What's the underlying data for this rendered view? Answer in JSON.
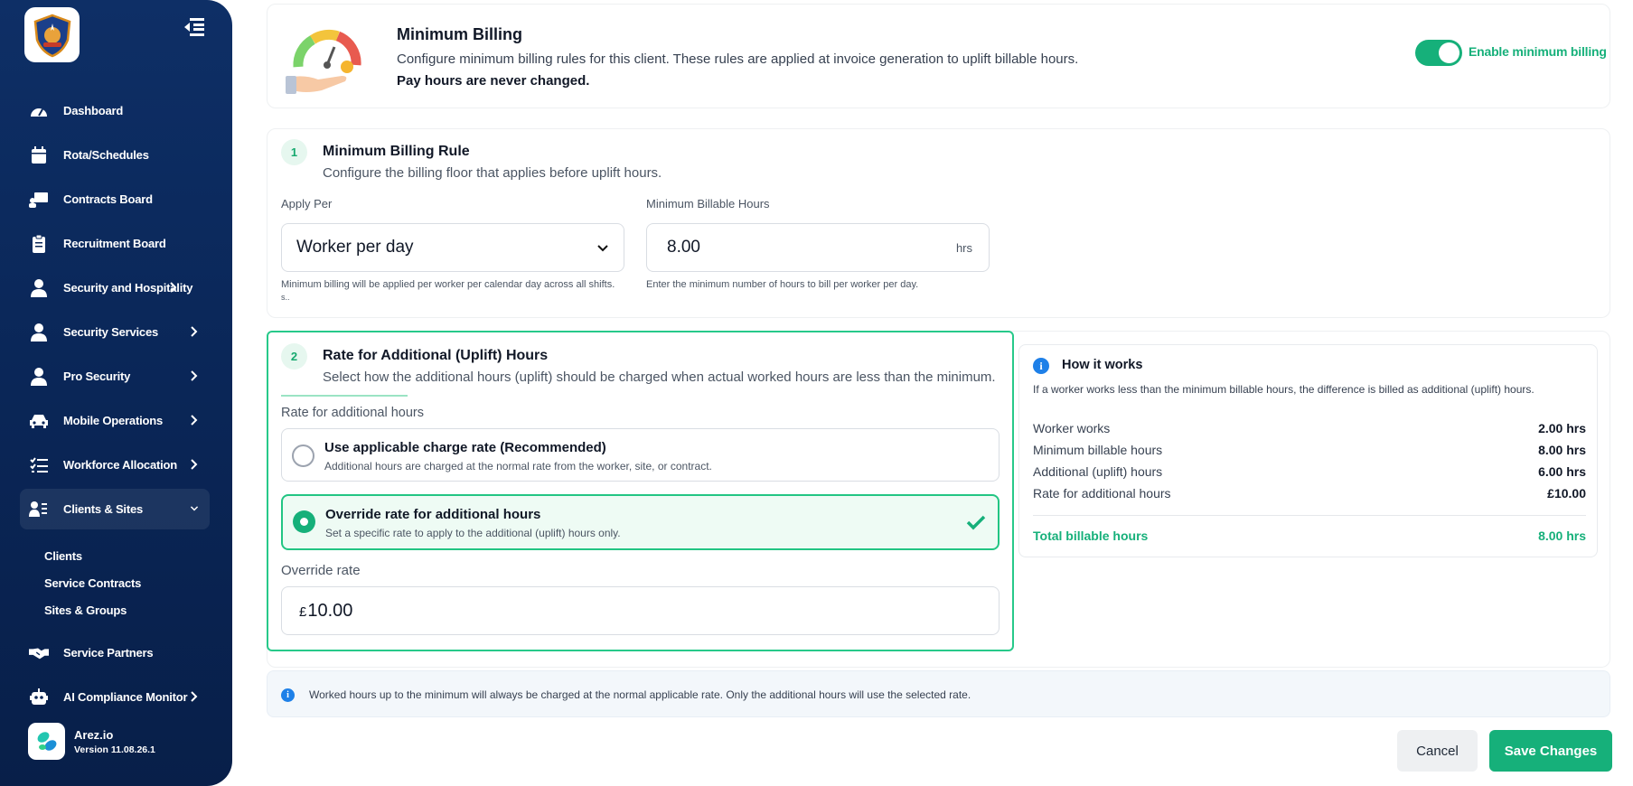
{
  "sidebar": {
    "items": [
      {
        "label": "Dashboard",
        "icon": "dashboard-gauge-icon"
      },
      {
        "label": "Rota/Schedules",
        "icon": "calendar-icon"
      },
      {
        "label": "Contracts Board",
        "icon": "presentation-board-icon"
      },
      {
        "label": "Recruitment Board",
        "icon": "clipboard-icon"
      },
      {
        "label": "Security and Hospitality",
        "icon": "user-icon"
      },
      {
        "label": "Security Services",
        "icon": "user-icon"
      },
      {
        "label": "Pro Security",
        "icon": "user-icon"
      },
      {
        "label": "Mobile Operations",
        "icon": "car-icon"
      },
      {
        "label": "Workforce Allocation",
        "icon": "list-check-icon"
      },
      {
        "label": "Clients & Sites",
        "icon": "clients-icon"
      }
    ],
    "subitems": [
      "Clients",
      "Service Contracts",
      "Sites & Groups"
    ],
    "bottom_items": [
      {
        "label": "Service Partners",
        "icon": "handshake-icon"
      },
      {
        "label": "AI Compliance Monitor",
        "icon": "robot-icon"
      }
    ],
    "brand_name": "Arez.io",
    "version": "Version 11.08.26.1"
  },
  "header": {
    "title": "Minimum Billing",
    "description": "Configure minimum billing rules for this client. These rules are applied at invoice generation to uplift billable hours.",
    "note_bold": "Pay hours are never changed.",
    "toggle_label": "Enable minimum billing",
    "toggle_on": true
  },
  "section1": {
    "step": "1",
    "title": "Minimum Billing Rule",
    "subtitle": "Configure the billing floor that applies before uplift hours.",
    "apply_per_label": "Apply Per",
    "apply_per_value": "Worker per day",
    "apply_per_hint": "Minimum billing will be applied per worker per calendar day across all shifts.",
    "apply_per_hint2": "s..",
    "min_hours_label": "Minimum Billable Hours",
    "min_hours_value": "8.00",
    "min_hours_unit": "hrs",
    "min_hours_hint": "Enter the minimum number of hours to bill per worker per day."
  },
  "section2": {
    "step": "2",
    "title": "Rate for Additional (Uplift) Hours",
    "subtitle": "Select how the additional hours (uplift) should be charged when actual worked hours are less than the minimum.",
    "rate_label": "Rate for additional hours",
    "options": [
      {
        "title": "Use applicable charge rate (Recommended)",
        "desc": "Additional hours are charged at the normal rate from the worker, site, or contract.",
        "selected": false
      },
      {
        "title": "Override rate for additional hours",
        "desc": "Set a specific rate to apply to the additional (uplift) hours only.",
        "selected": true
      }
    ],
    "override_label": "Override rate",
    "currency": "£",
    "override_value": "10.00"
  },
  "how_it_works": {
    "title": "How it works",
    "desc": "If a worker works less than the minimum billable hours, the difference is billed as additional (uplift) hours.",
    "rows": [
      {
        "label": "Worker works",
        "value": "2.00 hrs"
      },
      {
        "label": "Minimum billable hours",
        "value": "8.00 hrs"
      },
      {
        "label": "Additional (uplift) hours",
        "value": "6.00 hrs"
      },
      {
        "label": "Rate for additional hours",
        "value": "£10.00"
      }
    ],
    "total_label": "Total billable hours",
    "total_value": "8.00 hrs"
  },
  "info_note": "Worked hours up to the minimum will always be charged at the normal applicable rate. Only the additional hours will use the selected rate.",
  "buttons": {
    "cancel": "Cancel",
    "save": "Save Changes"
  },
  "colors": {
    "sidebar": "#0a2657",
    "accent": "#16b07a",
    "info": "#1e80e8"
  }
}
